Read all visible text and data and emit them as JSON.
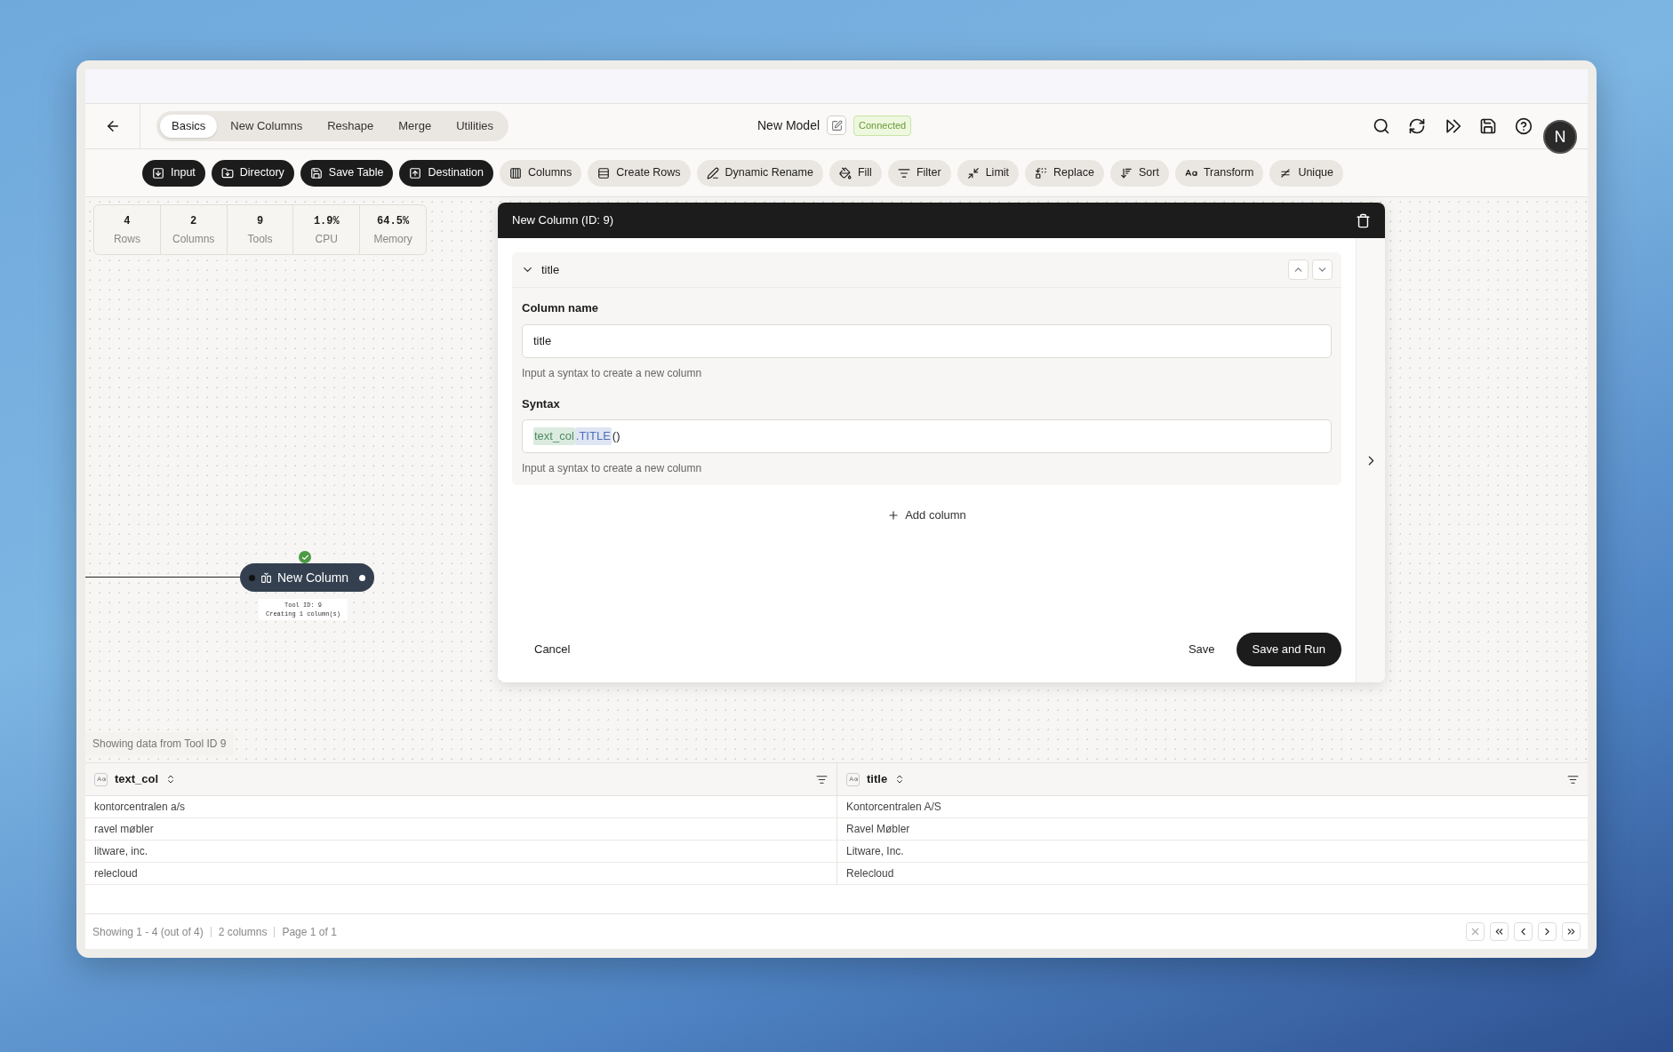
{
  "header": {
    "tabs": [
      {
        "label": "Basics",
        "selected": true
      },
      {
        "label": "New Columns",
        "selected": false
      },
      {
        "label": "Reshape",
        "selected": false
      },
      {
        "label": "Merge",
        "selected": false
      },
      {
        "label": "Utilities",
        "selected": false
      }
    ],
    "title": "New Model",
    "status": "Connected",
    "avatar": "N"
  },
  "toolbar": [
    {
      "label": "Input",
      "kind": "io"
    },
    {
      "label": "Directory",
      "kind": "io"
    },
    {
      "label": "Save Table",
      "kind": "io"
    },
    {
      "label": "Destination",
      "kind": "io"
    },
    {
      "label": "Columns",
      "kind": "tool"
    },
    {
      "label": "Create Rows",
      "kind": "tool"
    },
    {
      "label": "Dynamic Rename",
      "kind": "tool"
    },
    {
      "label": "Fill",
      "kind": "tool"
    },
    {
      "label": "Filter",
      "kind": "tool"
    },
    {
      "label": "Limit",
      "kind": "tool"
    },
    {
      "label": "Replace",
      "kind": "tool"
    },
    {
      "label": "Sort",
      "kind": "tool"
    },
    {
      "label": "Transform",
      "kind": "tool"
    },
    {
      "label": "Unique",
      "kind": "tool"
    }
  ],
  "stats": [
    {
      "value": "4",
      "label": "Rows"
    },
    {
      "value": "2",
      "label": "Columns"
    },
    {
      "value": "9",
      "label": "Tools"
    },
    {
      "value": "1.9%",
      "label": "CPU"
    },
    {
      "value": "64.5%",
      "label": "Memory"
    }
  ],
  "node": {
    "label": "New Column",
    "tool_id": "Tool ID: 9",
    "detail": "Creating 1 column(s)",
    "ok": true
  },
  "dialog": {
    "title": "New Column (ID: 9)",
    "section": {
      "title": "title",
      "expanded": true,
      "name_label": "Column name",
      "name_value": "title",
      "name_hint": "Input a syntax to create a new column",
      "syntax_label": "Syntax",
      "syntax_tokens": [
        {
          "text": "text_col",
          "kind": "column"
        },
        {
          "text": ".TITLE",
          "kind": "function"
        },
        {
          "text": "()",
          "kind": "plain"
        }
      ],
      "syntax_hint": "Input a syntax to create a new column"
    },
    "add": "Add column",
    "cancel": "Cancel",
    "save": "Save",
    "save_run": "Save and Run"
  },
  "data_source": "Showing data from Tool ID 9",
  "table": {
    "columns": [
      "text_col",
      "title"
    ],
    "rows": [
      [
        "kontorcentralen a/s",
        "Kontorcentralen A/S"
      ],
      [
        "ravel møbler",
        "Ravel Møbler"
      ],
      [
        "litware, inc.",
        "Litware, Inc."
      ],
      [
        "relecloud",
        "Relecloud"
      ]
    ]
  },
  "footer": {
    "range": "Showing 1 - 4 (out of 4)",
    "columns": "2 columns",
    "page": "Page 1 of 1"
  }
}
